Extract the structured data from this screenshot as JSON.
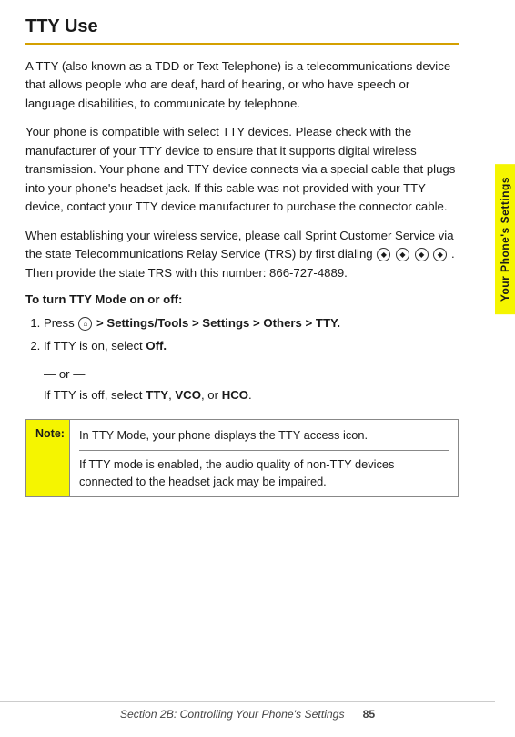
{
  "page": {
    "title": "TTY Use",
    "side_tab": "Your Phone's Settings",
    "paragraph1": "A TTY (also known as a TDD or Text Telephone) is a telecommunications device that allows people who are deaf, hard of hearing, or who have speech or language disabilities, to communicate by telephone.",
    "paragraph2": "Your phone is compatible with select TTY devices. Please check with the manufacturer of your TTY device to ensure that it supports digital wireless transmission. Your phone and TTY device connects via a special cable that plugs into your phone's headset jack. If this cable was not provided with your TTY device, contact your TTY device manufacturer to purchase the connector cable.",
    "paragraph3_prefix": "When establishing your wireless service, please call Sprint Customer Service via the state Telecommunications Relay Service (TRS) by first dialing",
    "paragraph3_suffix": ". Then provide the state TRS with this number: 866-727-4889.",
    "instruction_heading": "To turn TTY Mode on or off:",
    "steps": [
      {
        "number": "1.",
        "text_prefix": "Press",
        "text_bold": " > Settings/Tools > Settings > Others > TTY.",
        "has_icon": true
      },
      {
        "number": "2.",
        "text": "If TTY is on, select Off.",
        "or_text": "— or —",
        "alt_text": "If TTY is off, select TTY, VCO, or HCO."
      }
    ],
    "note": {
      "label": "Note:",
      "line1": "In TTY Mode, your phone displays the TTY access icon.",
      "line2": "If TTY mode is enabled, the audio quality of non-TTY devices connected to the headset jack may be impaired."
    },
    "footer": {
      "section_text": "Section 2B: Controlling Your Phone's Settings",
      "page_number": "85"
    }
  }
}
